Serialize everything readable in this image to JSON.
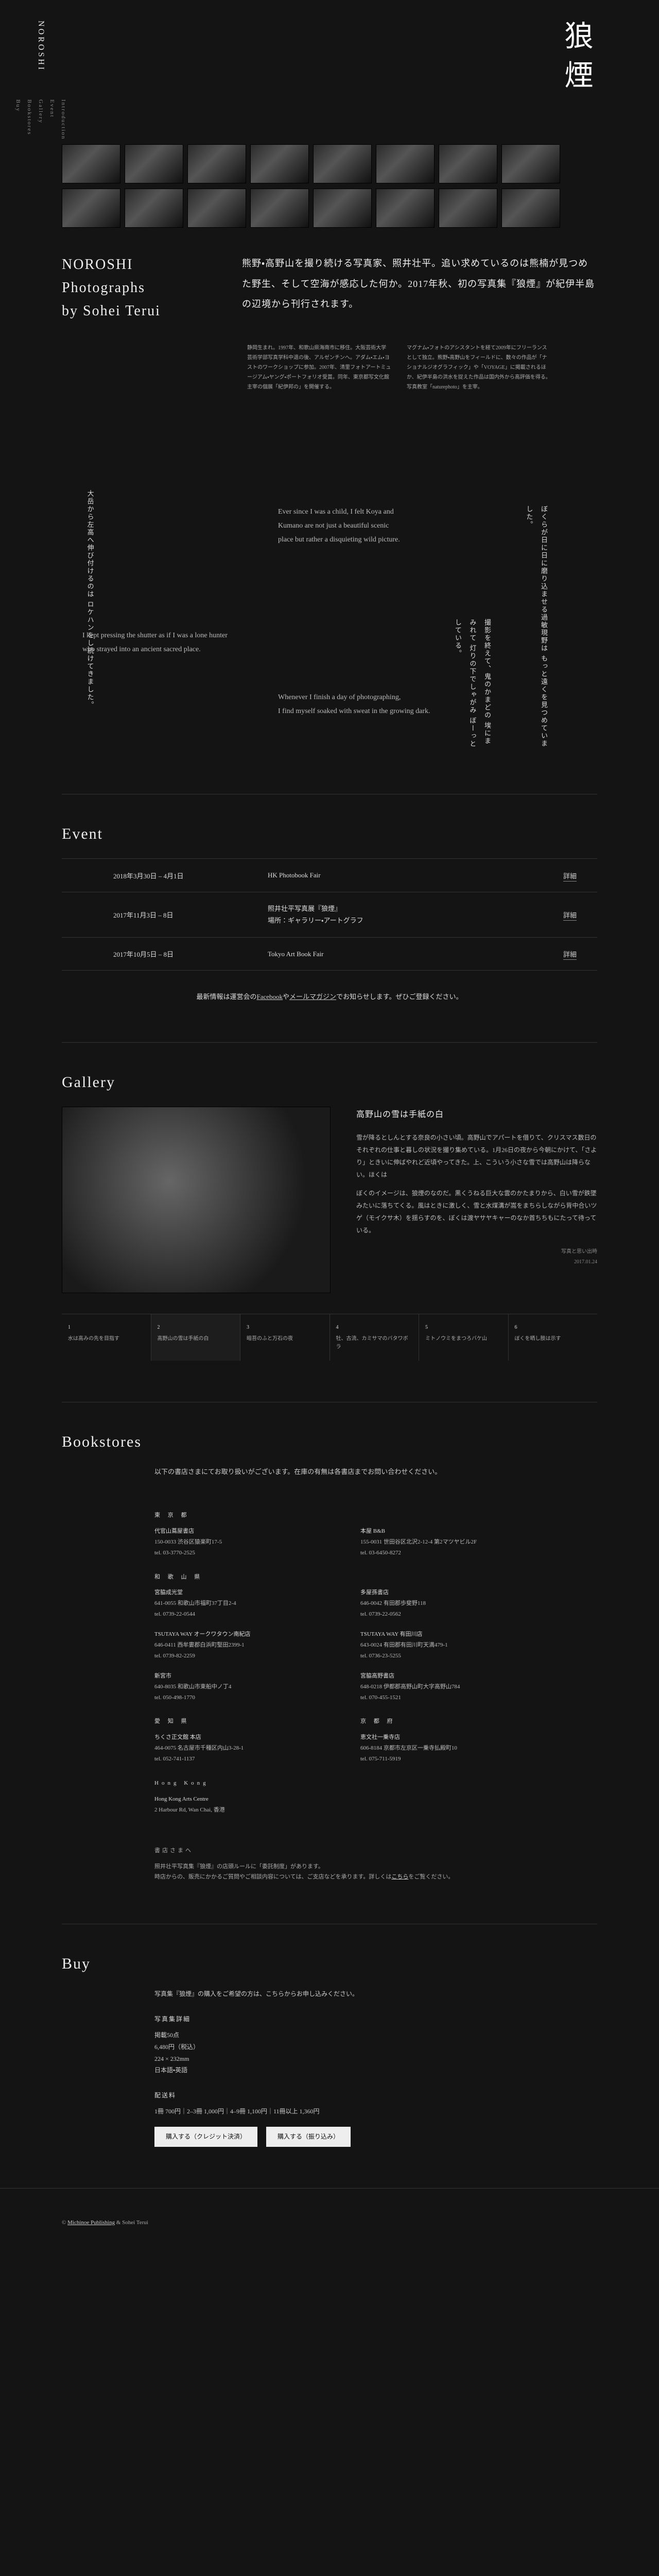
{
  "brand_vertical": "NOROSHI",
  "nav": [
    "Introduction",
    "Event",
    "Gallery",
    "Bookstores",
    "Buy"
  ],
  "hero": {
    "title_jp_1": "狼",
    "title_jp_2": "煙",
    "title_en_l1": "NOROSHI",
    "title_en_l2": "Photographs",
    "title_en_l3": "by Sohei Terui",
    "lead": "熊野・高野山を撮り続ける写真家、照井壮平。追い求めているのは熊楠が見つめた野生、そして空海が感応した何か。2017年秋、初の写真集『狼煙』が紀伊半島の辺境から刊行されます。",
    "small_left": "静岡生まれ。1997年、和歌山県海南市に移住。大阪芸術大学芸術学部写真学科中退の後、アルゼンチンへ。アダム・エム・ヨストのワークショップに参加。2007年、清里フォトアートミュージアム・ヤング・ポートフォリオ受賞。同年、東京都写文化館主宰の個展「紀伊邦の」を開催する。",
    "small_right": "マグナム・フォトのアシスタントを経て2009年にフリーランスとして独立。熊野・高野山をフィールドに、数々の作品が「ナショナルジオグラフィック」や「VOYAGE」に掲載されるほか、紀伊半島の洪水を捉えた作品は国内外から高評価を得る。写真教室「naturephoto」を主宰。"
  },
  "quotes": {
    "jp1": "大岳から左高へ伸び付けるのは\nロケハンをし続けてきました。",
    "en1": "Ever since I was a child, I felt Koya and\nKumano are not just a beautiful scenic\nplace but rather a disquieting wild picture.",
    "jp2": "ぼくらが日に日に磨り込ませる過敏現野は\nもっと遠くを見つめていました。",
    "en2": "I kept pressing the shutter as if I was a lone hunter\nwho strayed into an ancient sacred place.",
    "jp3": "撮影を終えて、鬼のかまどの\n埃にまみれて\n灯りの下でしゃがみ\nぼーっとしている。",
    "en3": "Whenever I finish a day of photographing,\nI find myself soaked with sweat in the growing dark."
  },
  "event": {
    "heading": "Event",
    "rows": [
      {
        "date": "2018年3月30日 – 4月1日",
        "name": "HK Photobook Fair",
        "link": "詳細"
      },
      {
        "date": "2017年11月3日 – 8日",
        "name": "照井壮平写真展『狼煙』\n場所：ギャラリー・アートグラフ",
        "link": "詳細"
      },
      {
        "date": "2017年10月5日 – 8日",
        "name": "Tokyo Art Book Fair",
        "link": "詳細"
      }
    ],
    "note_pre": "最新情報は運営会の",
    "note_link1": "Facebook",
    "note_mid": "や",
    "note_link2": "メールマガジン",
    "note_post": "でお知らせします。ぜひご登録ください。"
  },
  "gallery": {
    "heading": "Gallery",
    "item_title": "高野山の雪は手紙の白",
    "p1": "雪が降るとしんとする奈良の小さい頃。高野山でアパートを借りて、クリスマス数日のそれぞれの仕事と暮しの状況を撮り集めている。1月26日の夜から今朝にかけて、「さより」ときいに伸ばやれど近頃やってきた。上、こういう小さな雪では高野山は降らない。ほくは",
    "p2": "ぼくのイメージは、狼煙のなのだ。黒くうねる巨大な雲のかたまりから、白い雪が鉄墜みたいに落ちてくる。風はときに激しく、雪と水煤溝が嵩をまちらしながら背中合いツゲ（モイクサ木）を揺らすのを、ぼくは渡ヤサヤキャーのなか首ちちもにたって待っている。",
    "sig": "写真と思い出時",
    "date": "2017.01.24",
    "nav": [
      {
        "n": "1",
        "t": "水は高みの先を目指す"
      },
      {
        "n": "2",
        "t": "高野山の雪は手紙の白"
      },
      {
        "n": "3",
        "t": "暗苔のふと万石の夜"
      },
      {
        "n": "4",
        "t": "牡、古流、カミサマのバタワボラ"
      },
      {
        "n": "5",
        "t": "ミトノウミをまつろバケ山"
      },
      {
        "n": "6",
        "t": "ぼくを晒し肢は示す"
      }
    ]
  },
  "bookstores": {
    "heading": "Bookstores",
    "intro": "以下の書店さまにてお取り扱いがございます。在庫の有無は各書店までお問い合わせください。",
    "groups": [
      {
        "region": "東 京 都",
        "shops": [
          {
            "name": "代官山蔦屋書店",
            "addr": "150-0033 渋谷区猿楽町17-5",
            "tel": "tel. 03-3770-2525"
          },
          {
            "name": "本屋 B&B",
            "addr": "155-0031 世田谷区北沢2-12-4 第2マツヤビル2F",
            "tel": "tel. 03-6450-8272"
          }
        ]
      },
      {
        "region": "和 歌 山 県",
        "shops": [
          {
            "name": "宮脇成光堂",
            "addr": "641-0055 和歌山市福町37丁目2-4",
            "tel": "tel. 0739-22-0544"
          },
          {
            "name": "多屋孫書店",
            "addr": "646-0042 有田郡歩斐野118",
            "tel": "tel. 0739-22-0562"
          },
          {
            "name": "TSUTAYA WAY オークワタウン南紀店",
            "addr": "646-0411 西牟婁郡白浜町堅田2399-1",
            "tel": "tel. 0739-82-2259"
          },
          {
            "name": "TSUTAYA WAY 有田川店",
            "addr": "643-0024 有田郡有田川町天満479-1",
            "tel": "tel. 0736-23-5255"
          },
          {
            "name": "新宮市",
            "addr": "640-8035 和歌山市東船中ノ丁4",
            "tel": "tel. 050-498-1770"
          },
          {
            "name": "宮脇高野書店",
            "addr": "648-0218 伊都郡高野山町大字高野山784",
            "tel": "tel. 070-455-1521"
          }
        ]
      },
      {
        "region": "愛 知 県",
        "shops": [
          {
            "name": "ちくさ正文館 本店",
            "addr": "464-0075 名古屋市千種区内山3-28-1",
            "tel": "tel. 052-741-1137"
          }
        ]
      },
      {
        "region": "京 都 府",
        "shops": [
          {
            "name": "恵文社一乗寺店",
            "addr": "606-8184 京都市左京区一乗寺払殿町10",
            "tel": "tel. 075-711-5919"
          }
        ]
      },
      {
        "region": "Hong Kong",
        "shops": [
          {
            "name": "Hong Kong Arts Centre",
            "addr": "2 Harbour Rd, Wan Chai, 香港",
            "tel": ""
          }
        ]
      }
    ],
    "note_heading": "書店さまへ",
    "note1": "照井壮平写真集『狼煙』の店頭ルールに「委託制度」があります。",
    "note2": "時店からの、販売にかかるご質問やご相談内容については、ご支店などを承ります。詳しくは",
    "note2_link": "こちら",
    "note2_post": "をご覧ください。"
  },
  "buy": {
    "heading": "Buy",
    "intro": "写真集『狼煙』の購入をご希望の方は、こちらからお申し込みください。",
    "h_spec": "写真集詳細",
    "specs": [
      "掲載50点",
      "6,480円（税込）",
      "224 × 232mm",
      "日本語・英語"
    ],
    "h_ship": "配送料",
    "ship": "1冊 700円｜2–3冊 1,000円｜4–9冊 1,100円｜11冊以上 1,360円",
    "btn1": "購入する（クレジット決済）",
    "btn2": "購入する（振り込み）"
  },
  "footer": {
    "pre": "© ",
    "link": "Michinoe Publishing",
    "post": " & Sohei Terui"
  }
}
